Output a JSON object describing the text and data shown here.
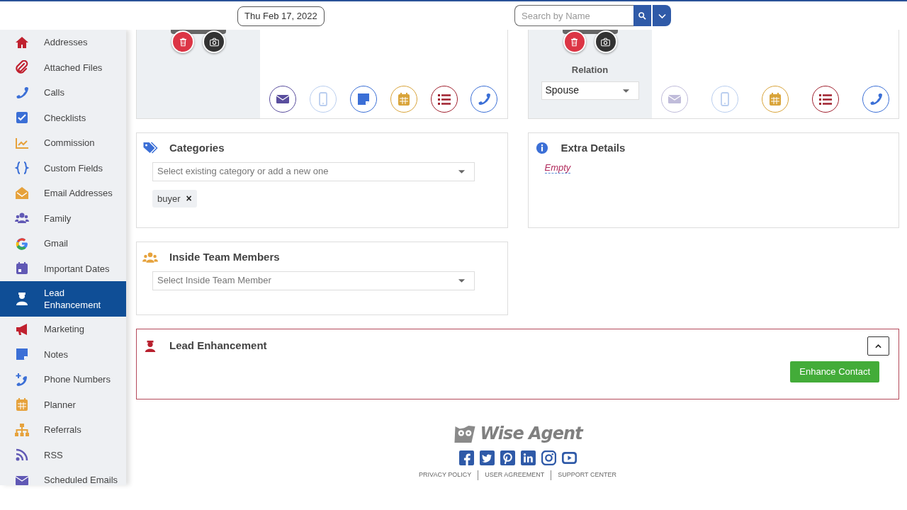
{
  "header": {
    "date": "Thu Feb 17, 2022",
    "search": {
      "placeholder": "Search by Name"
    }
  },
  "sidebar": {
    "items": [
      {
        "label": "Addresses",
        "kind": "house",
        "selected": false
      },
      {
        "label": "Attached Files",
        "kind": "paperclip",
        "selected": false
      },
      {
        "label": "Calls",
        "kind": "phone",
        "selected": false
      },
      {
        "label": "Checklists",
        "kind": "checkbox",
        "selected": false
      },
      {
        "label": "Commission",
        "kind": "chart",
        "selected": false
      },
      {
        "label": "Custom Fields",
        "kind": "braces",
        "selected": false
      },
      {
        "label": "Email Addresses",
        "kind": "envelope-open",
        "selected": false
      },
      {
        "label": "Family",
        "kind": "people",
        "selected": false
      },
      {
        "label": "Gmail",
        "kind": "google",
        "selected": false
      },
      {
        "label": "Important Dates",
        "kind": "calendar-day",
        "selected": false
      },
      {
        "label": "Lead Enhancement",
        "kind": "person",
        "selected": true
      },
      {
        "label": "Marketing",
        "kind": "megaphone",
        "selected": false
      },
      {
        "label": "Notes",
        "kind": "note",
        "selected": false
      },
      {
        "label": "Phone Numbers",
        "kind": "phone-plus",
        "selected": false
      },
      {
        "label": "Planner",
        "kind": "calendar",
        "selected": false
      },
      {
        "label": "Referrals",
        "kind": "sitemap",
        "selected": false
      },
      {
        "label": "RSS",
        "kind": "rss",
        "selected": false
      },
      {
        "label": "Scheduled Emails",
        "kind": "envelope",
        "selected": false
      }
    ]
  },
  "contact_cards": [
    {
      "actions": [
        {
          "kind": "email",
          "dimmed": false
        },
        {
          "kind": "mobile",
          "dimmed": true
        },
        {
          "kind": "note",
          "dimmed": false
        },
        {
          "kind": "calendar",
          "dimmed": false
        },
        {
          "kind": "list",
          "dimmed": false
        },
        {
          "kind": "phone",
          "dimmed": false
        }
      ]
    },
    {
      "relation": {
        "label": "Relation",
        "value": "Spouse"
      },
      "actions": [
        {
          "kind": "email",
          "dimmed": true
        },
        {
          "kind": "mobile",
          "dimmed": true
        },
        {
          "kind": "calendar",
          "dimmed": false
        },
        {
          "kind": "list",
          "dimmed": false
        },
        {
          "kind": "phone",
          "dimmed": false
        }
      ]
    }
  ],
  "categories": {
    "title": "Categories",
    "placeholder": "Select existing category or add a new one",
    "tags": [
      {
        "label": "buyer",
        "remove": "×"
      }
    ]
  },
  "extra_details": {
    "title": "Extra Details",
    "value": "Empty"
  },
  "inside_team": {
    "title": "Inside Team Members",
    "placeholder": "Select Inside Team Member"
  },
  "lead_enhancement": {
    "title": "Lead Enhancement",
    "expanded": true,
    "button": "Enhance Contact"
  },
  "footer": {
    "logo": "Wise Agent",
    "links": [
      "PRIVACY POLICY",
      "USER AGREEMENT",
      "SUPPORT CENTER"
    ]
  }
}
